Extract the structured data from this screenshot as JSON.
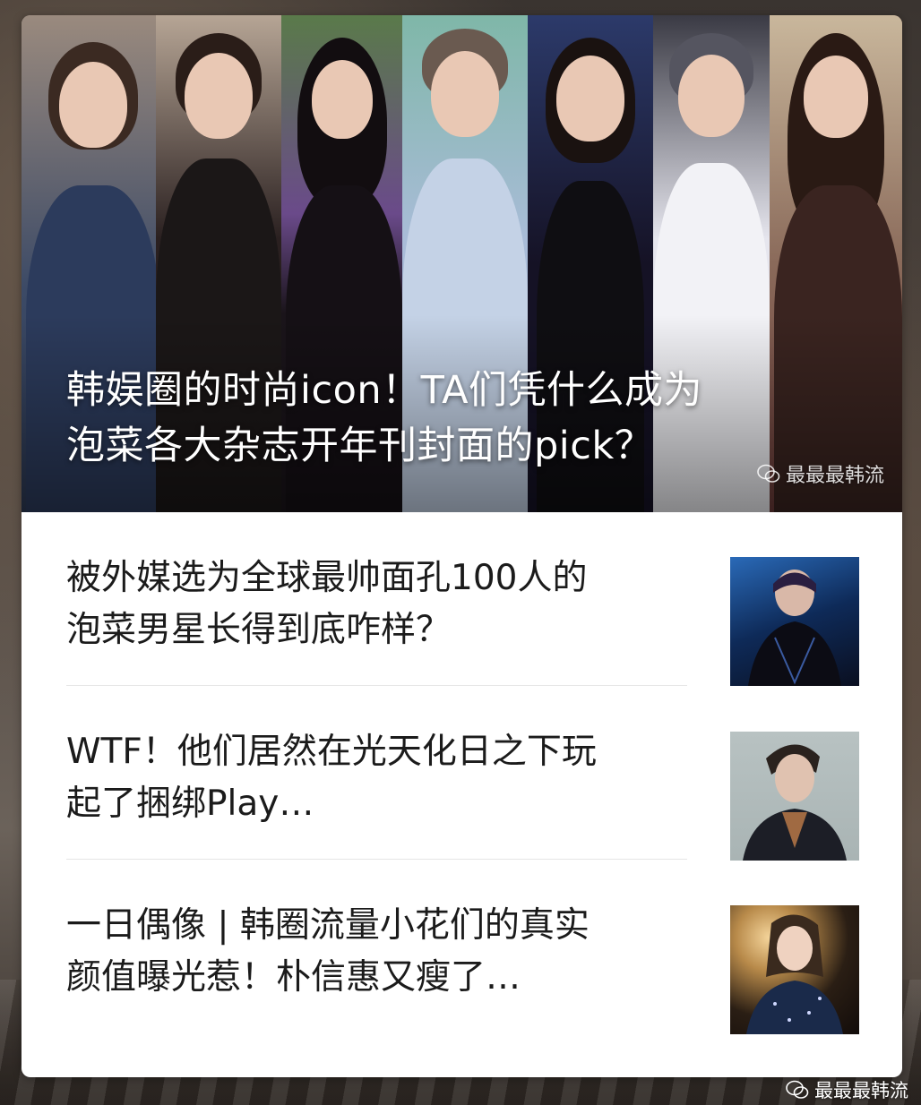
{
  "hero": {
    "title_line1": "韩娱圈的时尚icon！TA们凭什么成为",
    "title_line2": "泡菜各大杂志开年刊封面的pick？",
    "watermark": "最最最韩流"
  },
  "articles": [
    {
      "line1": "被外媒选为全球最帅面孔100人的",
      "line2": "泡菜男星长得到底咋样？",
      "thumb_icon": "performer-photo"
    },
    {
      "line1": "WTF！他们居然在光天化日之下玩",
      "line2": "起了捆绑Play…",
      "thumb_icon": "portrait-photo"
    },
    {
      "line1": "一日偶像 | 韩圈流量小花们的真实",
      "line2": "颜值曝光惹！朴信惠又瘦了…",
      "thumb_icon": "idol-photo"
    }
  ],
  "footer": {
    "watermark": "最最最韩流"
  },
  "colors": {
    "card_bg": "#ffffff",
    "text": "#1b1b1b",
    "divider": "#e6e6e6"
  }
}
